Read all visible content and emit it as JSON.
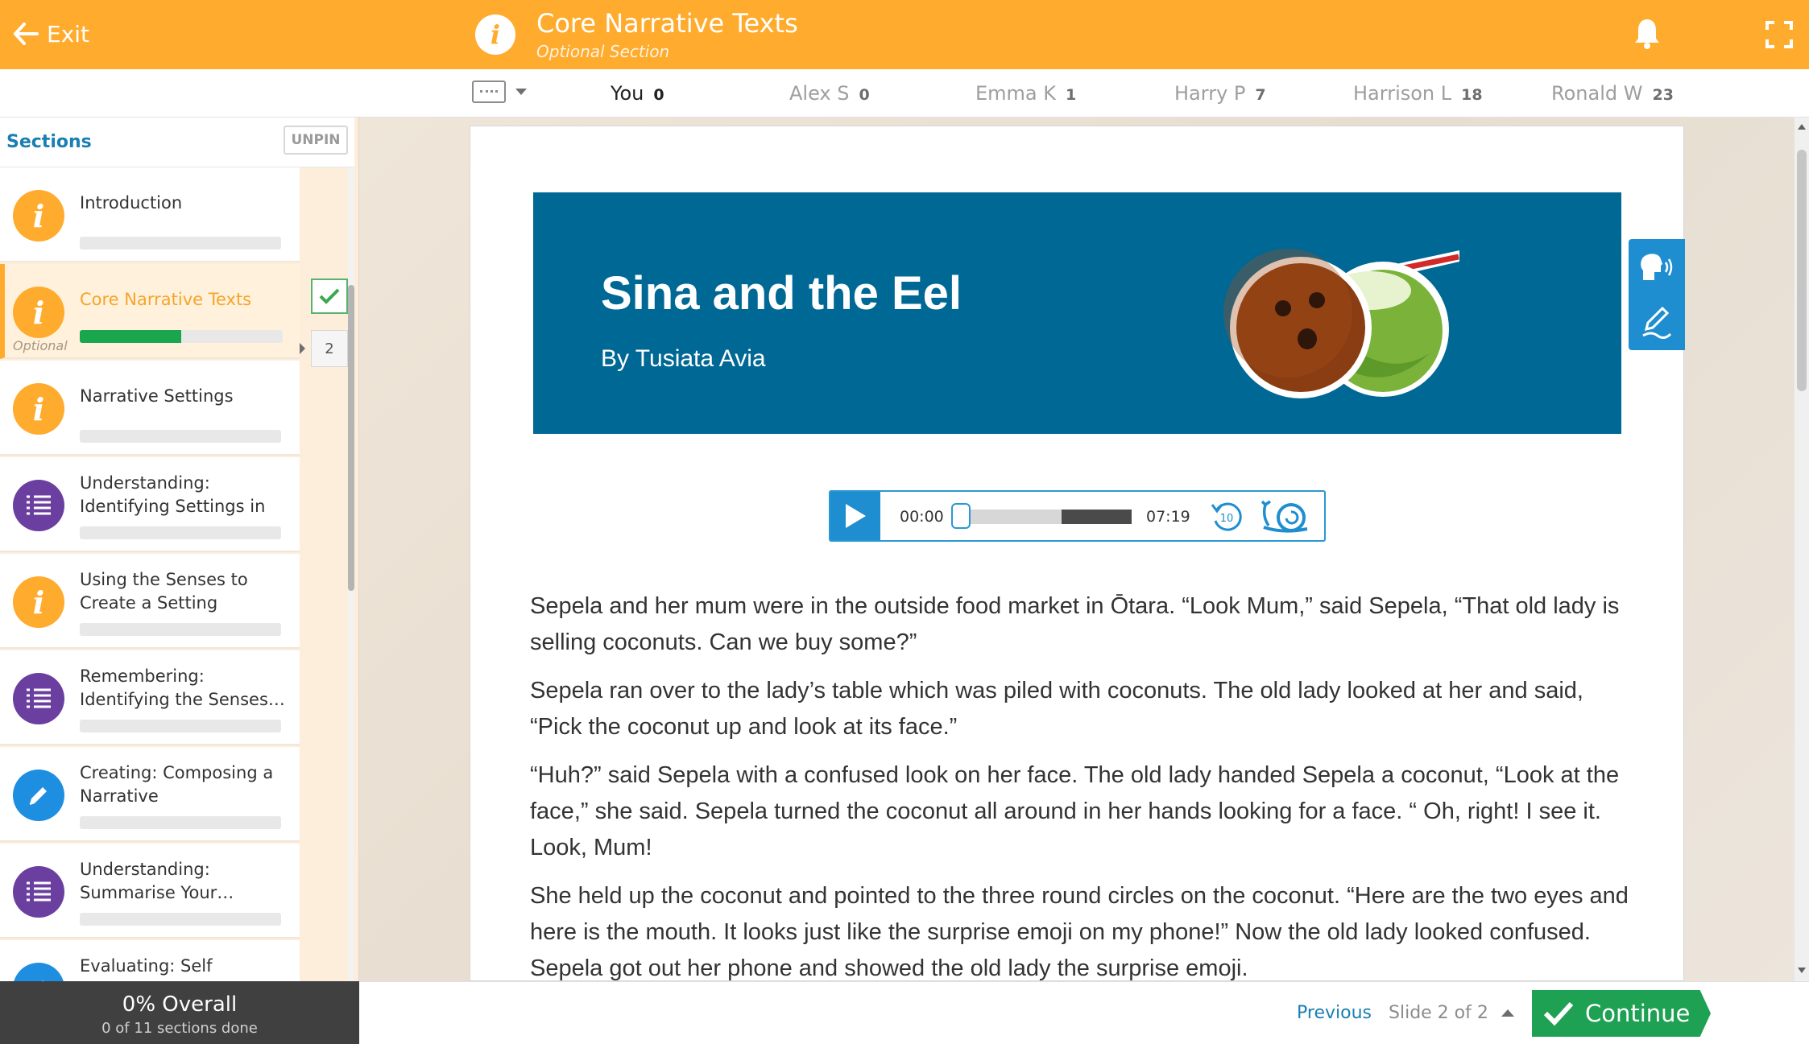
{
  "header": {
    "exit_label": "Exit",
    "title": "Core Narrative Texts",
    "subtitle": "Optional Section",
    "info_glyph": "i",
    "accent_color": "#ffab2d"
  },
  "leaderboard": {
    "players": [
      {
        "name": "You",
        "score": "0"
      },
      {
        "name": "Alex S",
        "score": "0"
      },
      {
        "name": "Emma K",
        "score": "1"
      },
      {
        "name": "Harry P",
        "score": "7"
      },
      {
        "name": "Harrison L",
        "score": "18"
      },
      {
        "name": "Ronald W",
        "score": "23"
      }
    ]
  },
  "sidebar": {
    "title": "Sections",
    "unpin_label": "UNPIN",
    "items": [
      {
        "label": "Introduction",
        "icon": "info-icon",
        "glyph": "i",
        "progress": 0
      },
      {
        "label": "Core Narrative Texts",
        "icon": "info-icon",
        "glyph": "i",
        "progress": 0.5,
        "tag": "Optional",
        "completed": true,
        "count": "2"
      },
      {
        "label": "Narrative Settings",
        "icon": "info-icon",
        "glyph": "i",
        "progress": 0
      },
      {
        "label": "Understanding: Identifying Settings in …",
        "icon": "list-icon",
        "progress": 0
      },
      {
        "label": "Using the Senses to Create a Setting",
        "icon": "info-icon",
        "glyph": "i",
        "progress": 0
      },
      {
        "label": "Remembering: Identifying the Senses…",
        "icon": "list-icon",
        "progress": 0
      },
      {
        "label": "Creating: Composing a Narrative",
        "icon": "pencil-icon",
        "progress": 0
      },
      {
        "label": "Understanding: Summarise Your…",
        "icon": "list-icon",
        "progress": 0
      },
      {
        "label": "Evaluating: Self",
        "icon": "pencil-icon",
        "progress": 0
      }
    ],
    "overall": {
      "percent_label": "0% Overall",
      "sections_done": "0 of 11 sections done"
    }
  },
  "banner": {
    "title": "Sina and the Eel",
    "author": "By Tusiata Avia",
    "bg_color": "#006894"
  },
  "audio": {
    "current_time": "00:00",
    "duration": "07:19",
    "rewind_label": "10",
    "played_fraction": 0,
    "buffered_from": 0.59,
    "buffered_to": 1.0
  },
  "story": {
    "paragraphs": [
      "Sepela and her mum were in the outside food market in Ōtara. “Look Mum,” said Sepela, “That old lady is selling coconuts. Can we buy some?”",
      "Sepela ran over to the lady’s table which was piled with coconuts. The old lady looked at her and said, “Pick the coconut up and look at its face.”",
      "“Huh?” said Sepela with a confused look on her face. The old lady handed Sepela a coconut, “Look at the face,” she said. Sepela turned the coconut all around in her hands looking for a face. “ Oh, right! I see it. Look, Mum!",
      "She held up the coconut and pointed to the three round circles on the coconut. “Here are the two eyes and here is the mouth. It looks just like the surprise emoji on my phone!” Now the old lady looked confused. Sepela got out her phone and showed the old lady the surprise emoji."
    ]
  },
  "footer": {
    "previous_label": "Previous",
    "slide_label": "Slide 2 of 2",
    "continue_label": "Continue",
    "continue_color": "#1fa154"
  }
}
